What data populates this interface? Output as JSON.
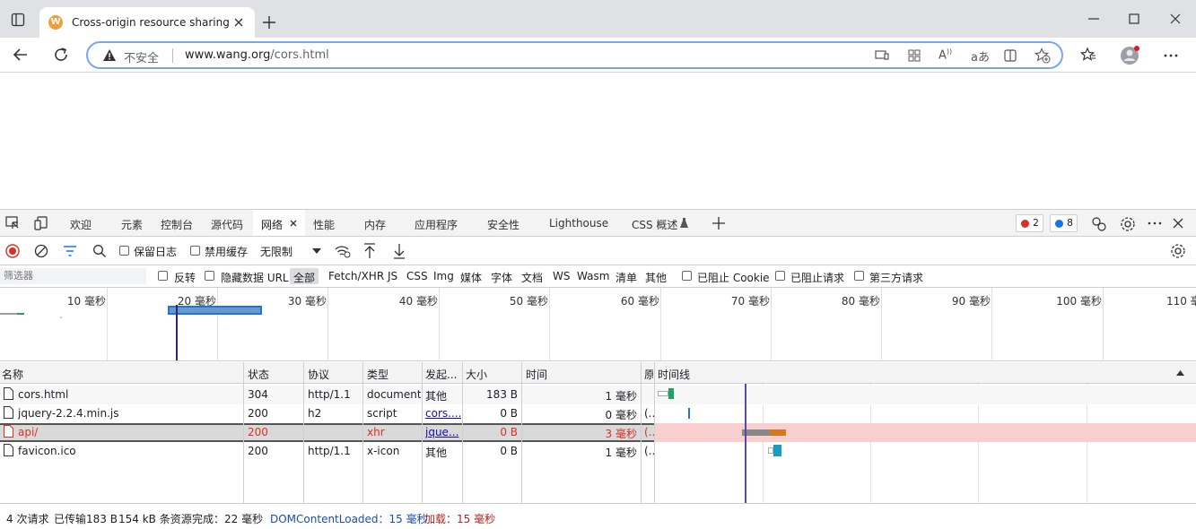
{
  "browser": {
    "tab_title": "Cross-origin resource sharing",
    "favicon_letter": "W",
    "insecure_label": "不安全",
    "url_host": "www.wang.org",
    "url_path": "/cors.html"
  },
  "devtools": {
    "tabs": [
      "欢迎",
      "元素",
      "控制台",
      "源代码",
      "网络",
      "性能",
      "内存",
      "应用程序",
      "安全性",
      "Lighthouse",
      "CSS 概述"
    ],
    "active_tab": "网络",
    "errors_count": "2",
    "messages_count": "8",
    "toolbar": {
      "preserve_log": "保留日志",
      "disable_cache": "禁用缓存",
      "throttle": "无限制"
    },
    "filter": {
      "placeholder": "筛选器",
      "invert": "反转",
      "hide_data_urls": "隐藏数据 URL",
      "types": [
        "全部",
        "Fetch/XHR",
        "JS",
        "CSS",
        "Img",
        "媒体",
        "字体",
        "文档",
        "WS",
        "Wasm",
        "清单",
        "其他"
      ],
      "blocked_cookies": "已阻止 Cookie",
      "blocked_requests": "已阻止请求",
      "third_party": "第三方请求"
    },
    "overview_ticks": [
      "10 毫秒",
      "20 毫秒",
      "30 毫秒",
      "40 毫秒",
      "50 毫秒",
      "60 毫秒",
      "70 毫秒",
      "80 毫秒",
      "90 毫秒",
      "100 毫秒",
      "110 毫"
    ],
    "columns": {
      "name": "名称",
      "status": "状态",
      "protocol": "协议",
      "type": "类型",
      "initiator": "发起...",
      "size": "大小",
      "time": "时间",
      "extra": "原",
      "waterfall": "时间线"
    },
    "requests": [
      {
        "name": "cors.html",
        "status": "304",
        "protocol": "http/1.1",
        "type": "document",
        "initiator": "其他",
        "size": "183 B",
        "time": "1 毫秒",
        "extra": ""
      },
      {
        "name": "jquery-2.2.4.min.js",
        "status": "200",
        "protocol": "h2",
        "type": "script",
        "initiator": "cors....",
        "size": "0 B",
        "time": "0 毫秒",
        "extra": "(..."
      },
      {
        "name": "api/",
        "status": "200",
        "protocol": "",
        "type": "xhr",
        "initiator": "jque...",
        "size": "0 B",
        "time": "3 毫秒",
        "extra": "(..."
      },
      {
        "name": "favicon.ico",
        "status": "200",
        "protocol": "http/1.1",
        "type": "x-icon",
        "initiator": "其他",
        "size": "0 B",
        "time": "1 毫秒",
        "extra": "(..."
      }
    ],
    "summary": {
      "requests": "4 次请求",
      "transferred": "已传输183 B",
      "resources": "154 kB 条资源",
      "finish": "完成：22 毫秒",
      "dcl": "DOMContentLoaded：15 毫秒",
      "load": "加载：15 毫秒"
    }
  }
}
